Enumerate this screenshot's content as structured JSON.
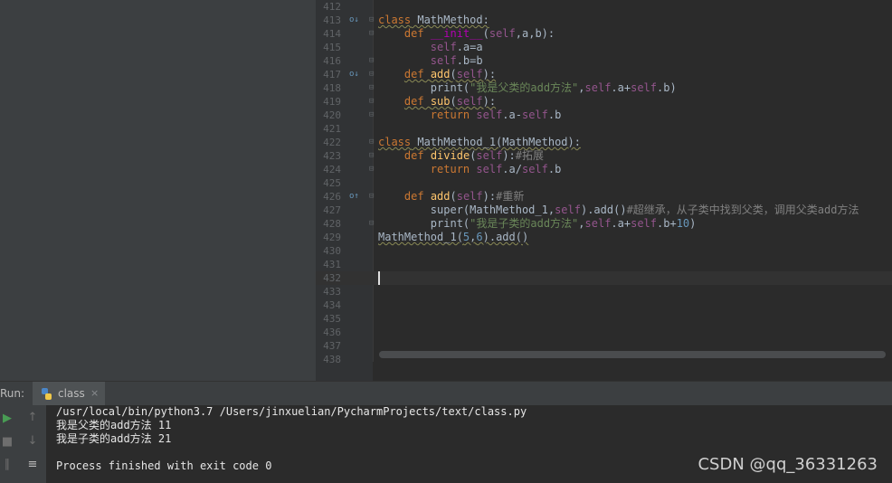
{
  "editor": {
    "lines": [
      {
        "num": "412",
        "marker": "",
        "fold": "",
        "segs": []
      },
      {
        "num": "413",
        "marker": "o↓",
        "fold": "⊟",
        "segs": [
          {
            "t": "class",
            "c": "kw sq"
          },
          {
            "t": " MathMethod:",
            "c": "sq"
          }
        ]
      },
      {
        "num": "414",
        "marker": "",
        "fold": "⊟",
        "segs": [
          {
            "t": "    "
          },
          {
            "t": "def",
            "c": "kw"
          },
          {
            "t": " "
          },
          {
            "t": "__init__",
            "c": "dn"
          },
          {
            "t": "("
          },
          {
            "t": "self",
            "c": "sf"
          },
          {
            "t": ",a,b):"
          }
        ]
      },
      {
        "num": "415",
        "marker": "",
        "fold": "",
        "segs": [
          {
            "t": "        "
          },
          {
            "t": "self",
            "c": "sf"
          },
          {
            "t": ".a=a"
          }
        ]
      },
      {
        "num": "416",
        "marker": "",
        "fold": "⊟",
        "segs": [
          {
            "t": "        "
          },
          {
            "t": "self",
            "c": "sf"
          },
          {
            "t": ".b=b"
          }
        ]
      },
      {
        "num": "417",
        "marker": "o↓",
        "fold": "⊟",
        "segs": [
          {
            "t": "    "
          },
          {
            "t": "def",
            "c": "kw sq"
          },
          {
            "t": " ",
            "c": "sq"
          },
          {
            "t": "add",
            "c": "fn sq"
          },
          {
            "t": "(",
            "c": "sq"
          },
          {
            "t": "self",
            "c": "sf sq"
          },
          {
            "t": "):",
            "c": "sq"
          }
        ]
      },
      {
        "num": "418",
        "marker": "",
        "fold": "⊟",
        "segs": [
          {
            "t": "        print("
          },
          {
            "t": "\"我是父类的add方法\"",
            "c": "st"
          },
          {
            "t": ","
          },
          {
            "t": "self",
            "c": "sf"
          },
          {
            "t": ".a+"
          },
          {
            "t": "self",
            "c": "sf"
          },
          {
            "t": ".b)"
          }
        ]
      },
      {
        "num": "419",
        "marker": "",
        "fold": "⊟",
        "segs": [
          {
            "t": "    "
          },
          {
            "t": "def",
            "c": "kw sq"
          },
          {
            "t": " ",
            "c": "sq"
          },
          {
            "t": "sub",
            "c": "fn sq"
          },
          {
            "t": "(",
            "c": "sq"
          },
          {
            "t": "self",
            "c": "sf sq"
          },
          {
            "t": "):",
            "c": "sq"
          }
        ]
      },
      {
        "num": "420",
        "marker": "",
        "fold": "⊟",
        "segs": [
          {
            "t": "        "
          },
          {
            "t": "return",
            "c": "kw"
          },
          {
            "t": " "
          },
          {
            "t": "self",
            "c": "sf"
          },
          {
            "t": ".a-"
          },
          {
            "t": "self",
            "c": "sf"
          },
          {
            "t": ".b"
          }
        ]
      },
      {
        "num": "421",
        "marker": "",
        "fold": "",
        "segs": []
      },
      {
        "num": "422",
        "marker": "",
        "fold": "⊟",
        "segs": [
          {
            "t": "class",
            "c": "kw sq"
          },
          {
            "t": " MathMethod_1(MathMethod):",
            "c": "sq"
          }
        ]
      },
      {
        "num": "423",
        "marker": "",
        "fold": "⊟",
        "segs": [
          {
            "t": "    "
          },
          {
            "t": "def",
            "c": "kw"
          },
          {
            "t": " "
          },
          {
            "t": "divide",
            "c": "fn"
          },
          {
            "t": "("
          },
          {
            "t": "self",
            "c": "sf"
          },
          {
            "t": "):"
          },
          {
            "t": "#拓展",
            "c": "cm"
          }
        ]
      },
      {
        "num": "424",
        "marker": "",
        "fold": "⊟",
        "segs": [
          {
            "t": "        "
          },
          {
            "t": "return",
            "c": "kw"
          },
          {
            "t": " "
          },
          {
            "t": "self",
            "c": "sf"
          },
          {
            "t": ".a/"
          },
          {
            "t": "self",
            "c": "sf"
          },
          {
            "t": ".b"
          }
        ]
      },
      {
        "num": "425",
        "marker": "",
        "fold": "",
        "segs": []
      },
      {
        "num": "426",
        "marker": "o↑",
        "fold": "⊟",
        "segs": [
          {
            "t": "    "
          },
          {
            "t": "def",
            "c": "kw"
          },
          {
            "t": " "
          },
          {
            "t": "add",
            "c": "fn"
          },
          {
            "t": "("
          },
          {
            "t": "self",
            "c": "sf"
          },
          {
            "t": "):"
          },
          {
            "t": "#重新",
            "c": "cm"
          }
        ]
      },
      {
        "num": "427",
        "marker": "",
        "fold": "",
        "segs": [
          {
            "t": "        super(MathMethod_1,"
          },
          {
            "t": "self",
            "c": "sf"
          },
          {
            "t": ").add()"
          },
          {
            "t": "#超继承，从子类中找到父类，调用父类add方法",
            "c": "cm"
          }
        ]
      },
      {
        "num": "428",
        "marker": "",
        "fold": "⊟",
        "segs": [
          {
            "t": "        print("
          },
          {
            "t": "\"我是子类的add方法\"",
            "c": "st"
          },
          {
            "t": ","
          },
          {
            "t": "self",
            "c": "sf"
          },
          {
            "t": ".a+"
          },
          {
            "t": "self",
            "c": "sf"
          },
          {
            "t": ".b+"
          },
          {
            "t": "10",
            "c": "nm"
          },
          {
            "t": ")"
          }
        ]
      },
      {
        "num": "429",
        "marker": "",
        "fold": "",
        "segs": [
          {
            "t": "MathMethod_1(",
            "c": "sq"
          },
          {
            "t": "5",
            "c": "nm sq"
          },
          {
            "t": ",",
            "c": "sq"
          },
          {
            "t": "6",
            "c": "nm sq"
          },
          {
            "t": ").add()",
            "c": "sq"
          }
        ]
      },
      {
        "num": "430",
        "marker": "",
        "fold": "",
        "segs": []
      },
      {
        "num": "431",
        "marker": "",
        "fold": "",
        "segs": []
      },
      {
        "num": "432",
        "marker": "",
        "fold": "",
        "segs": [],
        "current": true
      },
      {
        "num": "433",
        "marker": "",
        "fold": "",
        "segs": []
      },
      {
        "num": "434",
        "marker": "",
        "fold": "",
        "segs": []
      },
      {
        "num": "435",
        "marker": "",
        "fold": "",
        "segs": []
      },
      {
        "num": "436",
        "marker": "",
        "fold": "",
        "segs": []
      },
      {
        "num": "437",
        "marker": "",
        "fold": "",
        "segs": []
      },
      {
        "num": "438",
        "marker": "",
        "fold": "",
        "segs": []
      }
    ]
  },
  "run_panel": {
    "label": "Run:",
    "tab_name": "class",
    "tab_close": "×",
    "icons": [
      "play-icon",
      "up-arrow-icon",
      "stop-icon",
      "down-arrow-icon",
      "pause-icon",
      "soft-wrap-icon"
    ],
    "console_lines": [
      "/usr/local/bin/python3.7 /Users/jinxuelian/PycharmProjects/text/class.py",
      "我是父类的add方法 11",
      "我是子类的add方法 21",
      "",
      "Process finished with exit code 0"
    ]
  },
  "watermark": "CSDN @qq_36331263",
  "colors": {
    "keyword": "#cc7832",
    "function": "#ffc66d",
    "self": "#94558d",
    "string": "#6a8759",
    "number": "#6897bb",
    "comment": "#808080",
    "dunder": "#b200b2",
    "text": "#a9b7c6",
    "run_green": "#499c54"
  }
}
